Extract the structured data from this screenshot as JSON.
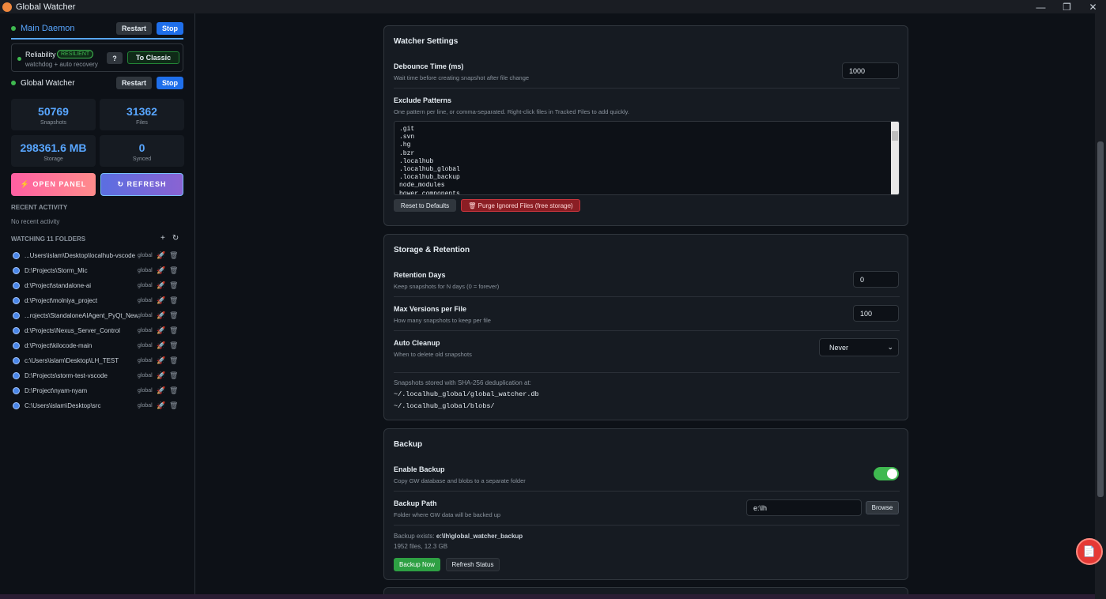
{
  "window": {
    "title": "Global Watcher",
    "controls": [
      "—",
      "❐",
      "✕"
    ]
  },
  "sidebar": {
    "main_daemon": {
      "name": "Main Daemon",
      "restart": "Restart",
      "stop": "Stop"
    },
    "reliability": {
      "title": "Reliability",
      "badge": "RESILIENT",
      "sub": "watchdog + auto recovery",
      "help": "?",
      "to_classic": "To Classic"
    },
    "global_watcher": {
      "name": "Global Watcher",
      "restart": "Restart",
      "stop": "Stop"
    },
    "stats": [
      {
        "value": "50769",
        "label": "Snapshots"
      },
      {
        "value": "31362",
        "label": "Files"
      },
      {
        "value": "298361.6 MB",
        "label": "Storage"
      },
      {
        "value": "0",
        "label": "Synced"
      }
    ],
    "open_panel": "⚡ OPEN PANEL",
    "refresh": "↻ REFRESH",
    "recent_activity_heading": "RECENT ACTIVITY",
    "no_recent": "No recent activity",
    "watching_heading": "WATCHING 11 FOLDERS",
    "add_icon": "+",
    "reload_icon": "↻",
    "folders": [
      {
        "path": "...Users\\islam\\Desktop\\localhub-vscode",
        "tag": "global"
      },
      {
        "path": "D:\\Projects\\Storm_Mic",
        "tag": "global"
      },
      {
        "path": "d:\\Project\\standalone-ai",
        "tag": "global"
      },
      {
        "path": "d:\\Project\\molniya_project",
        "tag": "global"
      },
      {
        "path": "...rojects\\StandaloneAIAgent_PyQt_New",
        "tag": "global"
      },
      {
        "path": "d:\\Projects\\Nexus_Server_Control",
        "tag": "global"
      },
      {
        "path": "d:\\Project\\kilocode-main",
        "tag": "global"
      },
      {
        "path": "c:\\Users\\islam\\Desktop\\LH_TEST",
        "tag": "global"
      },
      {
        "path": "D:\\Projects\\storm-test-vscode",
        "tag": "global"
      },
      {
        "path": "D:\\Project\\nyam-nyam",
        "tag": "global"
      },
      {
        "path": "C:\\Users\\islam\\Desktop\\src",
        "tag": "global"
      }
    ]
  },
  "watcher_settings": {
    "title": "Watcher Settings",
    "debounce": {
      "label": "Debounce Time (ms)",
      "desc": "Wait time before creating snapshot after file change",
      "value": "1000"
    },
    "exclude": {
      "label": "Exclude Patterns",
      "desc": "One pattern per line, or comma-separated. Right-click files in Tracked Files to add quickly.",
      "value": ".git\n.svn\n.hg\n.bzr\n.localhub\n.localhub_global\n.localhub_backup\nnode_modules\nbower_components"
    },
    "reset": "Reset to Defaults",
    "purge": "🗑 Purge Ignored Files (free storage)"
  },
  "storage": {
    "title": "Storage & Retention",
    "retention": {
      "label": "Retention Days",
      "desc": "Keep snapshots for N days (0 = forever)",
      "value": "0"
    },
    "max_versions": {
      "label": "Max Versions per File",
      "desc": "How many snapshots to keep per file",
      "value": "100"
    },
    "auto_cleanup": {
      "label": "Auto Cleanup",
      "desc": "When to delete old snapshots",
      "value": "Never"
    },
    "note": "Snapshots stored with SHA-256 deduplication at:",
    "db_path": "~/.localhub_global/global_watcher.db",
    "blobs_path": "~/.localhub_global/blobs/"
  },
  "backup": {
    "title": "Backup",
    "enable": {
      "label": "Enable Backup",
      "desc": "Copy GW database and blobs to a separate folder",
      "on": true
    },
    "path": {
      "label": "Backup Path",
      "desc": "Folder where GW data will be backed up",
      "value": "e:\\lh",
      "browse": "Browse"
    },
    "exists_prefix": "Backup exists:",
    "exists_path": "e:\\lh\\global_watcher_backup",
    "exists_stats": "1952 files, 12.3 GB",
    "backup_now": "Backup Now",
    "refresh_status": "Refresh Status"
  },
  "colors": {
    "accent": "#58a6ff",
    "success": "#3fb950",
    "danger": "#c9353d",
    "bg": "#0d1117",
    "card": "#161b22"
  }
}
